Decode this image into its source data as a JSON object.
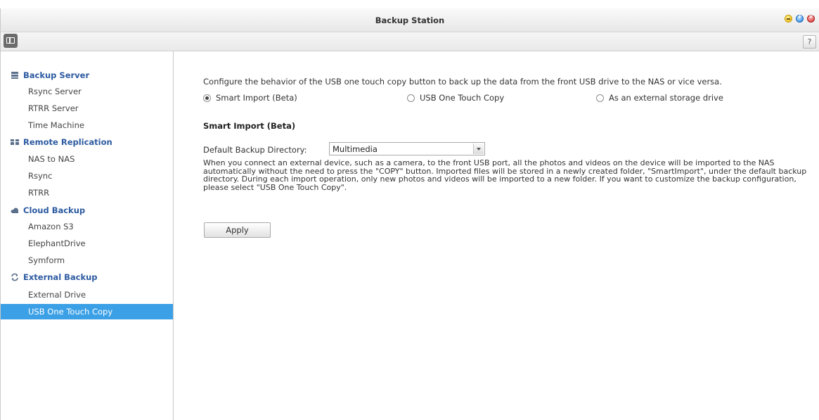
{
  "window": {
    "title": "Backup Station"
  },
  "toolbar": {
    "help_label": "?"
  },
  "sidebar": {
    "groups": [
      {
        "label": "Backup Server",
        "icon": "server-icon",
        "items": [
          "Rsync Server",
          "RTRR Server",
          "Time Machine"
        ]
      },
      {
        "label": "Remote Replication",
        "icon": "replication-icon",
        "items": [
          "NAS to NAS",
          "Rsync",
          "RTRR"
        ]
      },
      {
        "label": "Cloud Backup",
        "icon": "cloud-icon",
        "items": [
          "Amazon S3",
          "ElephantDrive",
          "Symform"
        ]
      },
      {
        "label": "External Backup",
        "icon": "sync-arrows-icon",
        "items": [
          "External Drive",
          "USB One Touch Copy"
        ]
      }
    ],
    "active_item": "USB One Touch Copy"
  },
  "main": {
    "description": "Configure the behavior of the USB one touch copy button to back up the data from the front USB drive to the NAS or vice versa.",
    "options": [
      {
        "label": "Smart Import (Beta)",
        "selected": true
      },
      {
        "label": "USB One Touch Copy",
        "selected": false
      },
      {
        "label": "As an external storage drive",
        "selected": false
      }
    ],
    "section_title": "Smart Import (Beta)",
    "directory_label": "Default Backup Directory:",
    "directory_value": "Multimedia",
    "paragraph": "When you connect an external device, such as a camera, to the front USB port, all the photos and videos on the device will be imported to the NAS automatically without the need to press the \"COPY\" button. Imported files will be stored in a newly created folder, \"SmartImport\", under the default backup directory. During each import operation, only new photos and videos will be imported to a new folder. If you want to customize the backup configuration, please select \"USB One Touch Copy\".",
    "apply_label": "Apply"
  },
  "colors": {
    "accent": "#3ba0e6",
    "group_heading": "#2c5aa0"
  }
}
